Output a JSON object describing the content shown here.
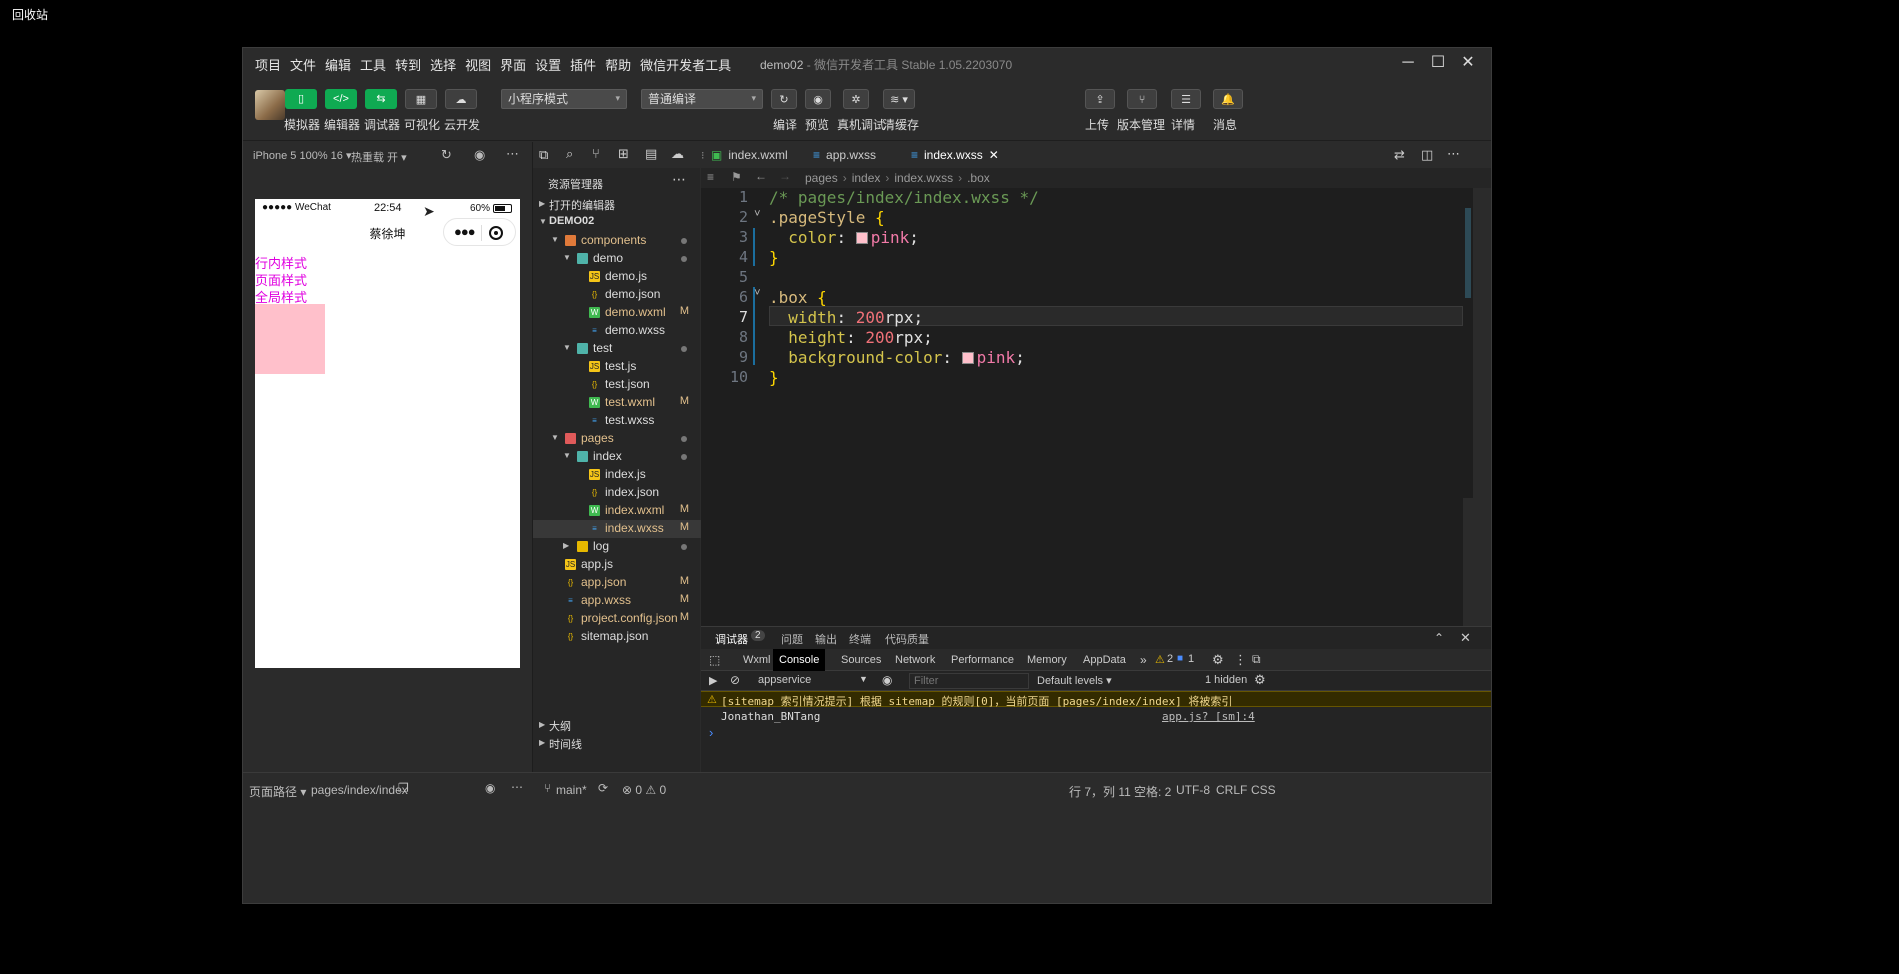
{
  "desktop": {
    "label": "回收站"
  },
  "window": {
    "menus": [
      "项目",
      "文件",
      "编辑",
      "工具",
      "转到",
      "选择",
      "视图",
      "界面",
      "设置",
      "插件",
      "帮助",
      "微信开发者工具"
    ],
    "project": "demo02",
    "title_rest": " - 微信开发者工具 Stable 1.05.2203070",
    "controls": {
      "minimize": "─",
      "maximize": "☐",
      "close": "✕"
    }
  },
  "toolbar": {
    "left_buttons": [
      {
        "label": "模拟器",
        "icon": "phone-icon",
        "glyph": "▯"
      },
      {
        "label": "编辑器",
        "icon": "code-icon",
        "glyph": "</>"
      },
      {
        "label": "调试器",
        "icon": "debug-icon",
        "glyph": "⇆"
      },
      {
        "label": "可视化",
        "icon": "layout-icon",
        "glyph": "▦"
      },
      {
        "label": "云开发",
        "icon": "cloud-icon",
        "glyph": "☁"
      }
    ],
    "mode_select": "小程序模式",
    "compile_select": "普通编译",
    "center_buttons": [
      {
        "label": "编译",
        "icon": "refresh-icon",
        "glyph": "↻"
      },
      {
        "label": "预览",
        "icon": "eye-icon",
        "glyph": "◉"
      },
      {
        "label": "真机调试",
        "icon": "bug-icon",
        "glyph": "✲"
      },
      {
        "label": "清缓存",
        "icon": "layers-icon",
        "glyph": "≋ ▾"
      }
    ],
    "right_buttons": [
      {
        "label": "上传",
        "icon": "upload-icon",
        "glyph": "⇪"
      },
      {
        "label": "版本管理",
        "icon": "branch-icon",
        "glyph": "⑂"
      },
      {
        "label": "详情",
        "icon": "menu-icon",
        "glyph": "☰"
      },
      {
        "label": "消息",
        "icon": "bell-icon",
        "glyph": "🔔"
      }
    ]
  },
  "simulator": {
    "device": "iPhone 5 100% 16 ▾",
    "hot_reload": "热重载 开 ▾",
    "status_left": "●●●●● WeChat",
    "time": "22:54",
    "battery": "60%",
    "nav_title": "蔡徐坤",
    "texts": [
      "行内样式",
      "页面样式",
      "全局样式"
    ],
    "box_color": "#ffc0cb",
    "text_color": "#e000e0"
  },
  "explorer": {
    "title": "资源管理器",
    "open_editors": "打开的编辑器",
    "root": "DEMO02",
    "items": [
      {
        "label": "components",
        "depth": 1,
        "type": "folder",
        "open": true,
        "dot": true
      },
      {
        "label": "demo",
        "depth": 2,
        "type": "folder",
        "open": true,
        "dot": true
      },
      {
        "label": "demo.js",
        "depth": 3,
        "type": "js"
      },
      {
        "label": "demo.json",
        "depth": 3,
        "type": "json"
      },
      {
        "label": "demo.wxml",
        "depth": 3,
        "type": "wxml",
        "mark": "M"
      },
      {
        "label": "demo.wxss",
        "depth": 3,
        "type": "wxss"
      },
      {
        "label": "test",
        "depth": 2,
        "type": "folder",
        "open": true,
        "dot": true
      },
      {
        "label": "test.js",
        "depth": 3,
        "type": "js"
      },
      {
        "label": "test.json",
        "depth": 3,
        "type": "json"
      },
      {
        "label": "test.wxml",
        "depth": 3,
        "type": "wxml",
        "mark": "M"
      },
      {
        "label": "test.wxss",
        "depth": 3,
        "type": "wxss"
      },
      {
        "label": "pages",
        "depth": 1,
        "type": "folder",
        "open": true,
        "dot": true
      },
      {
        "label": "index",
        "depth": 2,
        "type": "folder",
        "open": true,
        "dot": true
      },
      {
        "label": "index.js",
        "depth": 3,
        "type": "js"
      },
      {
        "label": "index.json",
        "depth": 3,
        "type": "json"
      },
      {
        "label": "index.wxml",
        "depth": 3,
        "type": "wxml",
        "mark": "M"
      },
      {
        "label": "index.wxss",
        "depth": 3,
        "type": "wxss",
        "mark": "M",
        "selected": true
      },
      {
        "label": "log",
        "depth": 2,
        "type": "folder",
        "open": false,
        "dot": true
      },
      {
        "label": "app.js",
        "depth": 1,
        "type": "js"
      },
      {
        "label": "app.json",
        "depth": 1,
        "type": "json",
        "mark": "M"
      },
      {
        "label": "app.wxss",
        "depth": 1,
        "type": "wxss",
        "mark": "M"
      },
      {
        "label": "project.config.json",
        "depth": 1,
        "type": "json",
        "mark": "M"
      },
      {
        "label": "sitemap.json",
        "depth": 1,
        "type": "json"
      }
    ],
    "outline": "大纲",
    "timeline": "时间线"
  },
  "editor": {
    "tabs": [
      {
        "label": "index.wxml",
        "icon": "wxml-file-icon"
      },
      {
        "label": "app.wxss",
        "icon": "wxss-file-icon"
      },
      {
        "label": "index.wxss",
        "icon": "wxss-file-icon",
        "active": true
      }
    ],
    "breadcrumb": [
      "pages",
      "index",
      "index.wxss",
      ".box"
    ],
    "line_numbers": [
      "1",
      "2",
      "3",
      "4",
      "5",
      "6",
      "7",
      "8",
      "9",
      "10"
    ],
    "lines": [
      "/* pages/index/index.wxss */",
      ".pageStyle {",
      "  color: pink;",
      "}",
      "",
      ".box {",
      "  width: 200rpx;",
      "  height: 200rpx;",
      "  background-color: pink;",
      "}"
    ]
  },
  "console": {
    "panel_tabs": [
      "调试器",
      "问题",
      "输出",
      "终端",
      "代码质量"
    ],
    "debugger_badge": "2",
    "devtools_tabs": [
      "Wxml",
      "Console",
      "Sources",
      "Network",
      "Performance",
      "Memory",
      "AppData"
    ],
    "warn_count": "2",
    "info_count": "1",
    "context": "appservice",
    "filter_placeholder": "Filter",
    "levels": "Default levels ▾",
    "hidden": "1 hidden",
    "warning": "[sitemap 索引情况提示] 根据 sitemap 的规则[0]，当前页面 [pages/index/index] 将被索引",
    "log": "Jonathan_BNTang",
    "log_source": "app.js? [sm]:4",
    "prompt": "›"
  },
  "statusbar": {
    "page_path_label": "页面路径 ▾",
    "page_path": "pages/index/index",
    "branch": "main*",
    "problems": "⊗ 0 ⚠ 0",
    "position": "行 7，列 11",
    "spaces": "空格: 2",
    "encoding": "UTF-8",
    "eol": "CRLF",
    "language": "CSS"
  }
}
